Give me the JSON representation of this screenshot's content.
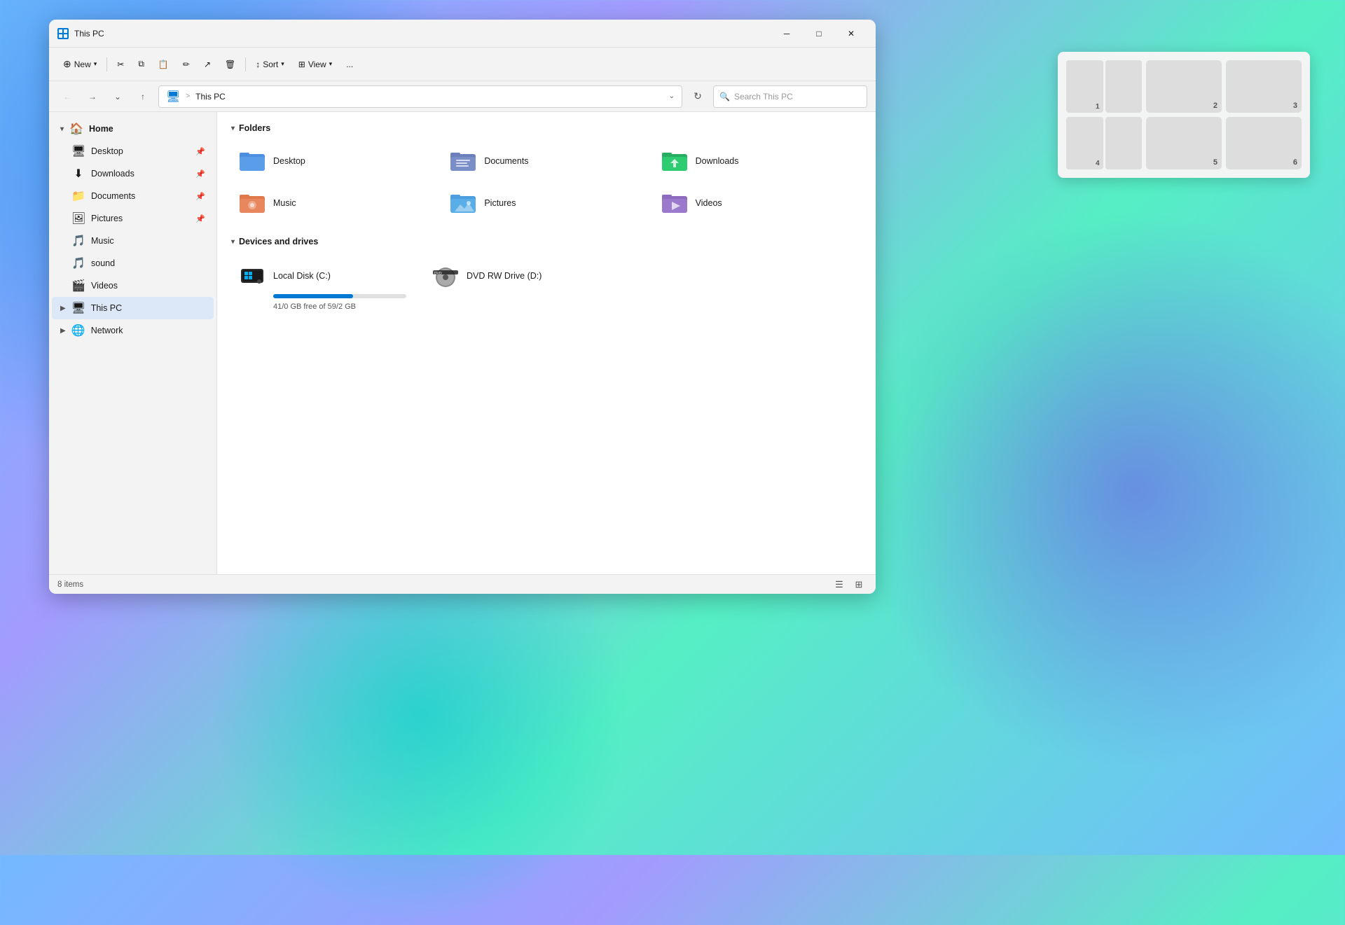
{
  "window": {
    "title": "This PC",
    "titleBarIcon": "🖥",
    "statusCount": "8 items"
  },
  "toolbar": {
    "newLabel": "New",
    "cutLabel": "✂",
    "copyLabel": "⧉",
    "pasteLabel": "📋",
    "renameLabel": "✏",
    "shareLabel": "↗",
    "deleteLabel": "🗑",
    "sortLabel": "Sort",
    "viewLabel": "View",
    "moreLabel": "..."
  },
  "addressBar": {
    "folderIcon": "🖥",
    "pathRoot": "This PC",
    "separator": ">",
    "pathCurrent": "This PC",
    "searchPlaceholder": "Search This PC"
  },
  "sidebar": {
    "home": {
      "label": "Home",
      "icon": "🏠"
    },
    "items": [
      {
        "label": "Desktop",
        "icon": "🖥",
        "pinned": true
      },
      {
        "label": "Downloads",
        "icon": "⬇",
        "pinned": true
      },
      {
        "label": "Documents",
        "icon": "📁",
        "pinned": true
      },
      {
        "label": "Pictures",
        "icon": "🖼",
        "pinned": true
      },
      {
        "label": "Music",
        "icon": "🎵"
      },
      {
        "label": "sound",
        "icon": "🎵"
      },
      {
        "label": "Videos",
        "icon": "🎬"
      }
    ],
    "thisPc": {
      "label": "This PC",
      "icon": "🖥",
      "active": true
    },
    "network": {
      "label": "Network",
      "icon": "🌐"
    }
  },
  "folders": {
    "sectionLabel": "Folders",
    "items": [
      {
        "name": "Desktop",
        "color": "#4c8fe0"
      },
      {
        "name": "Documents",
        "color": "#6b7fbd"
      },
      {
        "name": "Downloads",
        "color": "#27ae60"
      },
      {
        "name": "Music",
        "color": "#e0784c"
      },
      {
        "name": "Pictures",
        "color": "#4c9ee0"
      },
      {
        "name": "Videos",
        "color": "#8e6bbf"
      }
    ]
  },
  "devices": {
    "sectionLabel": "Devices and drives",
    "items": [
      {
        "name": "Local Disk (C:)",
        "icon": "win",
        "freeSpace": "41/0 GB free of 59/2 GB",
        "fillPercent": 60
      },
      {
        "name": "DVD RW Drive (D:)",
        "icon": "dvd",
        "freeSpace": "",
        "fillPercent": 0
      }
    ]
  },
  "snapLayout": {
    "cells": [
      {
        "id": 1,
        "label": "1"
      },
      {
        "id": 2,
        "label": "2"
      },
      {
        "id": 3,
        "label": "3"
      },
      {
        "id": 4,
        "label": "4"
      },
      {
        "id": 5,
        "label": "5"
      },
      {
        "id": 6,
        "label": "6"
      }
    ]
  }
}
